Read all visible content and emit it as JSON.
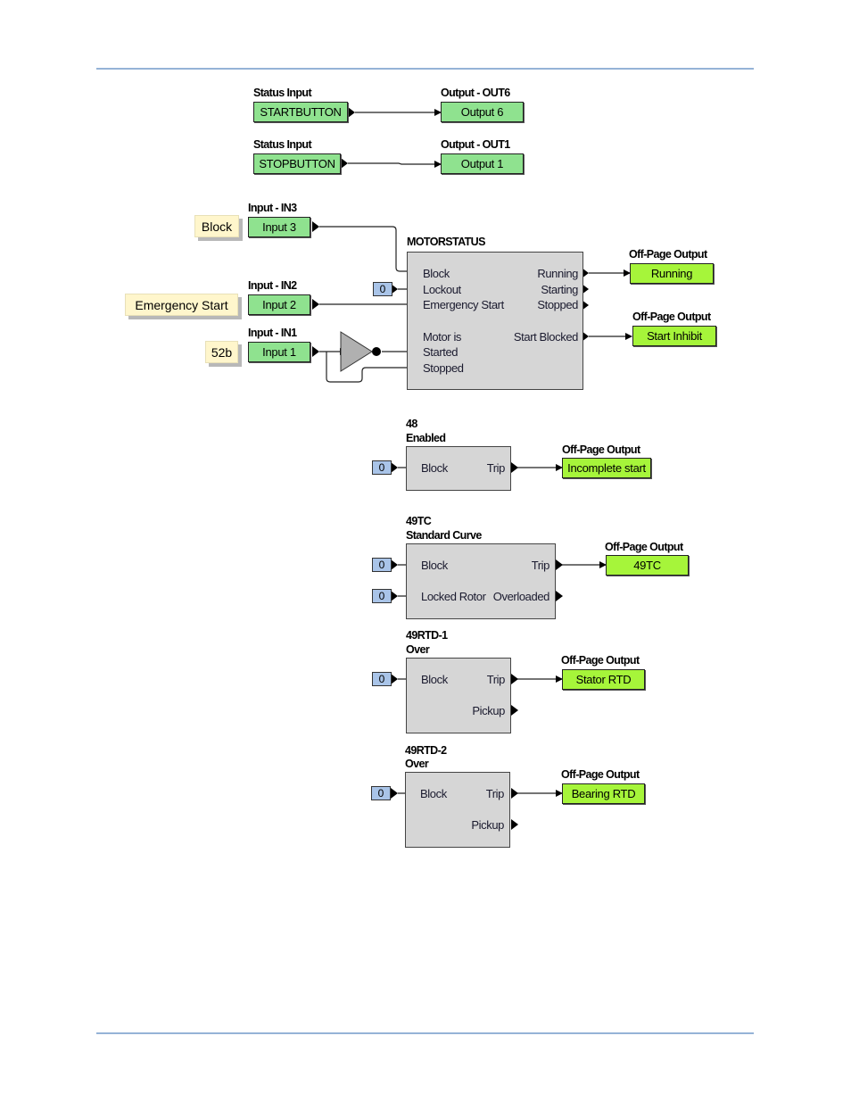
{
  "page": {
    "rule_color": "#95b3d7"
  },
  "colors": {
    "input_green": "#8fe28f",
    "output_lime": "#a6f53a",
    "block_gray": "#d6d6d6",
    "constant_blue": "#a9c4e8",
    "note_yellow": "#fff6cc"
  },
  "status_io": [
    {
      "input_title": "Status Input",
      "input_value": "STARTBUTTON",
      "output_title": "Output - OUT6",
      "output_value": "Output 6"
    },
    {
      "input_title": "Status Input",
      "input_value": "STOPBUTTON",
      "output_title": "Output - OUT1",
      "output_value": "Output 1"
    }
  ],
  "inputs": [
    {
      "title": "Input - IN3",
      "value": "Input 3",
      "note": "Block"
    },
    {
      "title": "Input - IN2",
      "value": "Input 2",
      "note": "Emergency Start"
    },
    {
      "title": "Input - IN1",
      "value": "Input 1",
      "note": "52b"
    }
  ],
  "motorstatus": {
    "title": "MOTORSTATUS",
    "lockout_constant": "0",
    "inputs": [
      "Block",
      "Lockout",
      "Emergency Start",
      "Motor is",
      "Started",
      "Stopped"
    ],
    "outputs": [
      "Running",
      "Starting",
      "Stopped",
      "Start Blocked"
    ],
    "offpage": [
      {
        "title": "Off-Page Output",
        "value": "Running"
      },
      {
        "title": "Off-Page Output",
        "value": "Start Inhibit"
      }
    ]
  },
  "blocks": [
    {
      "title1": "48",
      "title2": "Enabled",
      "in1": "Block",
      "const1": "0",
      "out1": "Trip",
      "off_title": "Off-Page Output",
      "off_value": "Incomplete start"
    },
    {
      "title1": "49TC",
      "title2": "Standard Curve",
      "in1": "Block",
      "const1": "0",
      "in2": "Locked Rotor",
      "const2": "0",
      "out1": "Trip",
      "out2": "Overloaded",
      "off_title": "Off-Page Output",
      "off_value": "49TC"
    },
    {
      "title1": "49RTD-1",
      "title2": "Over",
      "in1": "Block",
      "const1": "0",
      "out1": "Trip",
      "out2": "Pickup",
      "off_title": "Off-Page Output",
      "off_value": "Stator RTD"
    },
    {
      "title1": "49RTD-2",
      "title2": "Over",
      "in1": "Block",
      "const1": "0",
      "out1": "Trip",
      "out2": "Pickup",
      "off_title": "Off-Page Output",
      "off_value": "Bearing RTD"
    }
  ]
}
